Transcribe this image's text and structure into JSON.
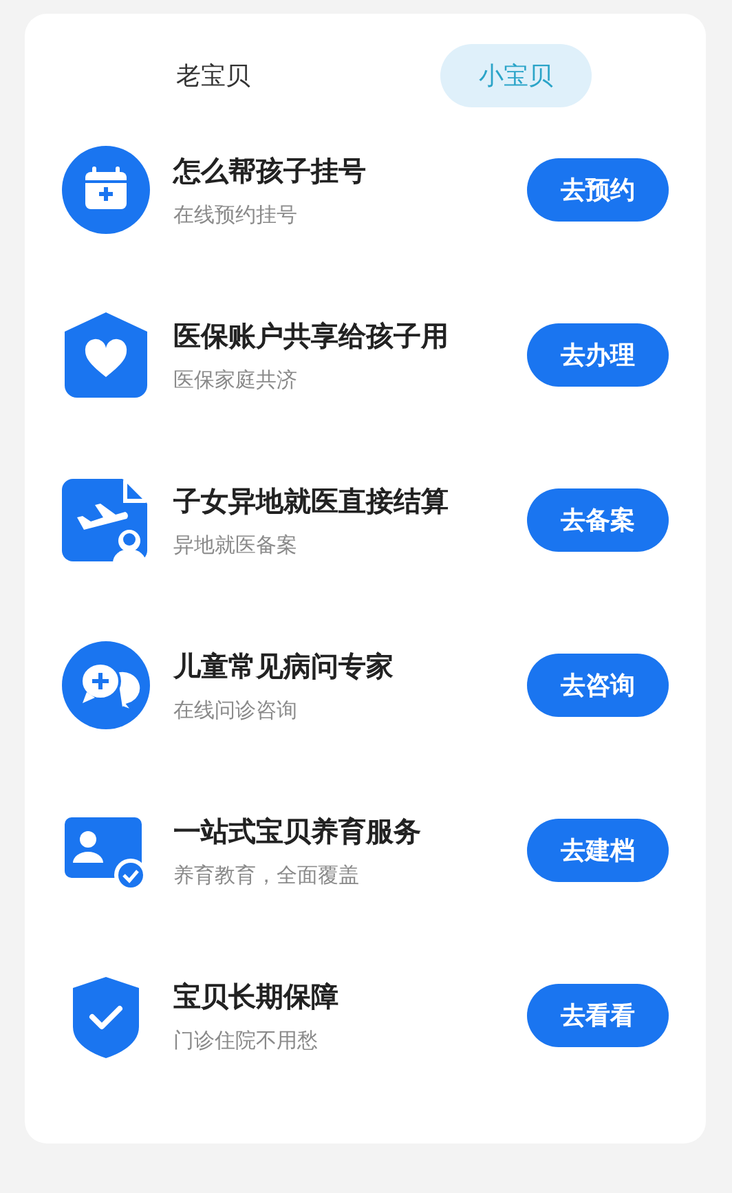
{
  "tabs": [
    {
      "label": "老宝贝",
      "selected": false
    },
    {
      "label": "小宝贝",
      "selected": true
    }
  ],
  "services": [
    {
      "title": "怎么帮孩子挂号",
      "subtitle": "在线预约挂号",
      "button": "去预约"
    },
    {
      "title": "医保账户共享给孩子用",
      "subtitle": "医保家庭共济",
      "button": "去办理"
    },
    {
      "title": "子女异地就医直接结算",
      "subtitle": "异地就医备案",
      "button": "去备案"
    },
    {
      "title": "儿童常见病问专家",
      "subtitle": "在线问诊咨询",
      "button": "去咨询"
    },
    {
      "title": "一站式宝贝养育服务",
      "subtitle": "养育教育，全面覆盖",
      "button": "去建档"
    },
    {
      "title": "宝贝长期保障",
      "subtitle": "门诊住院不用愁",
      "button": "去看看"
    }
  ]
}
